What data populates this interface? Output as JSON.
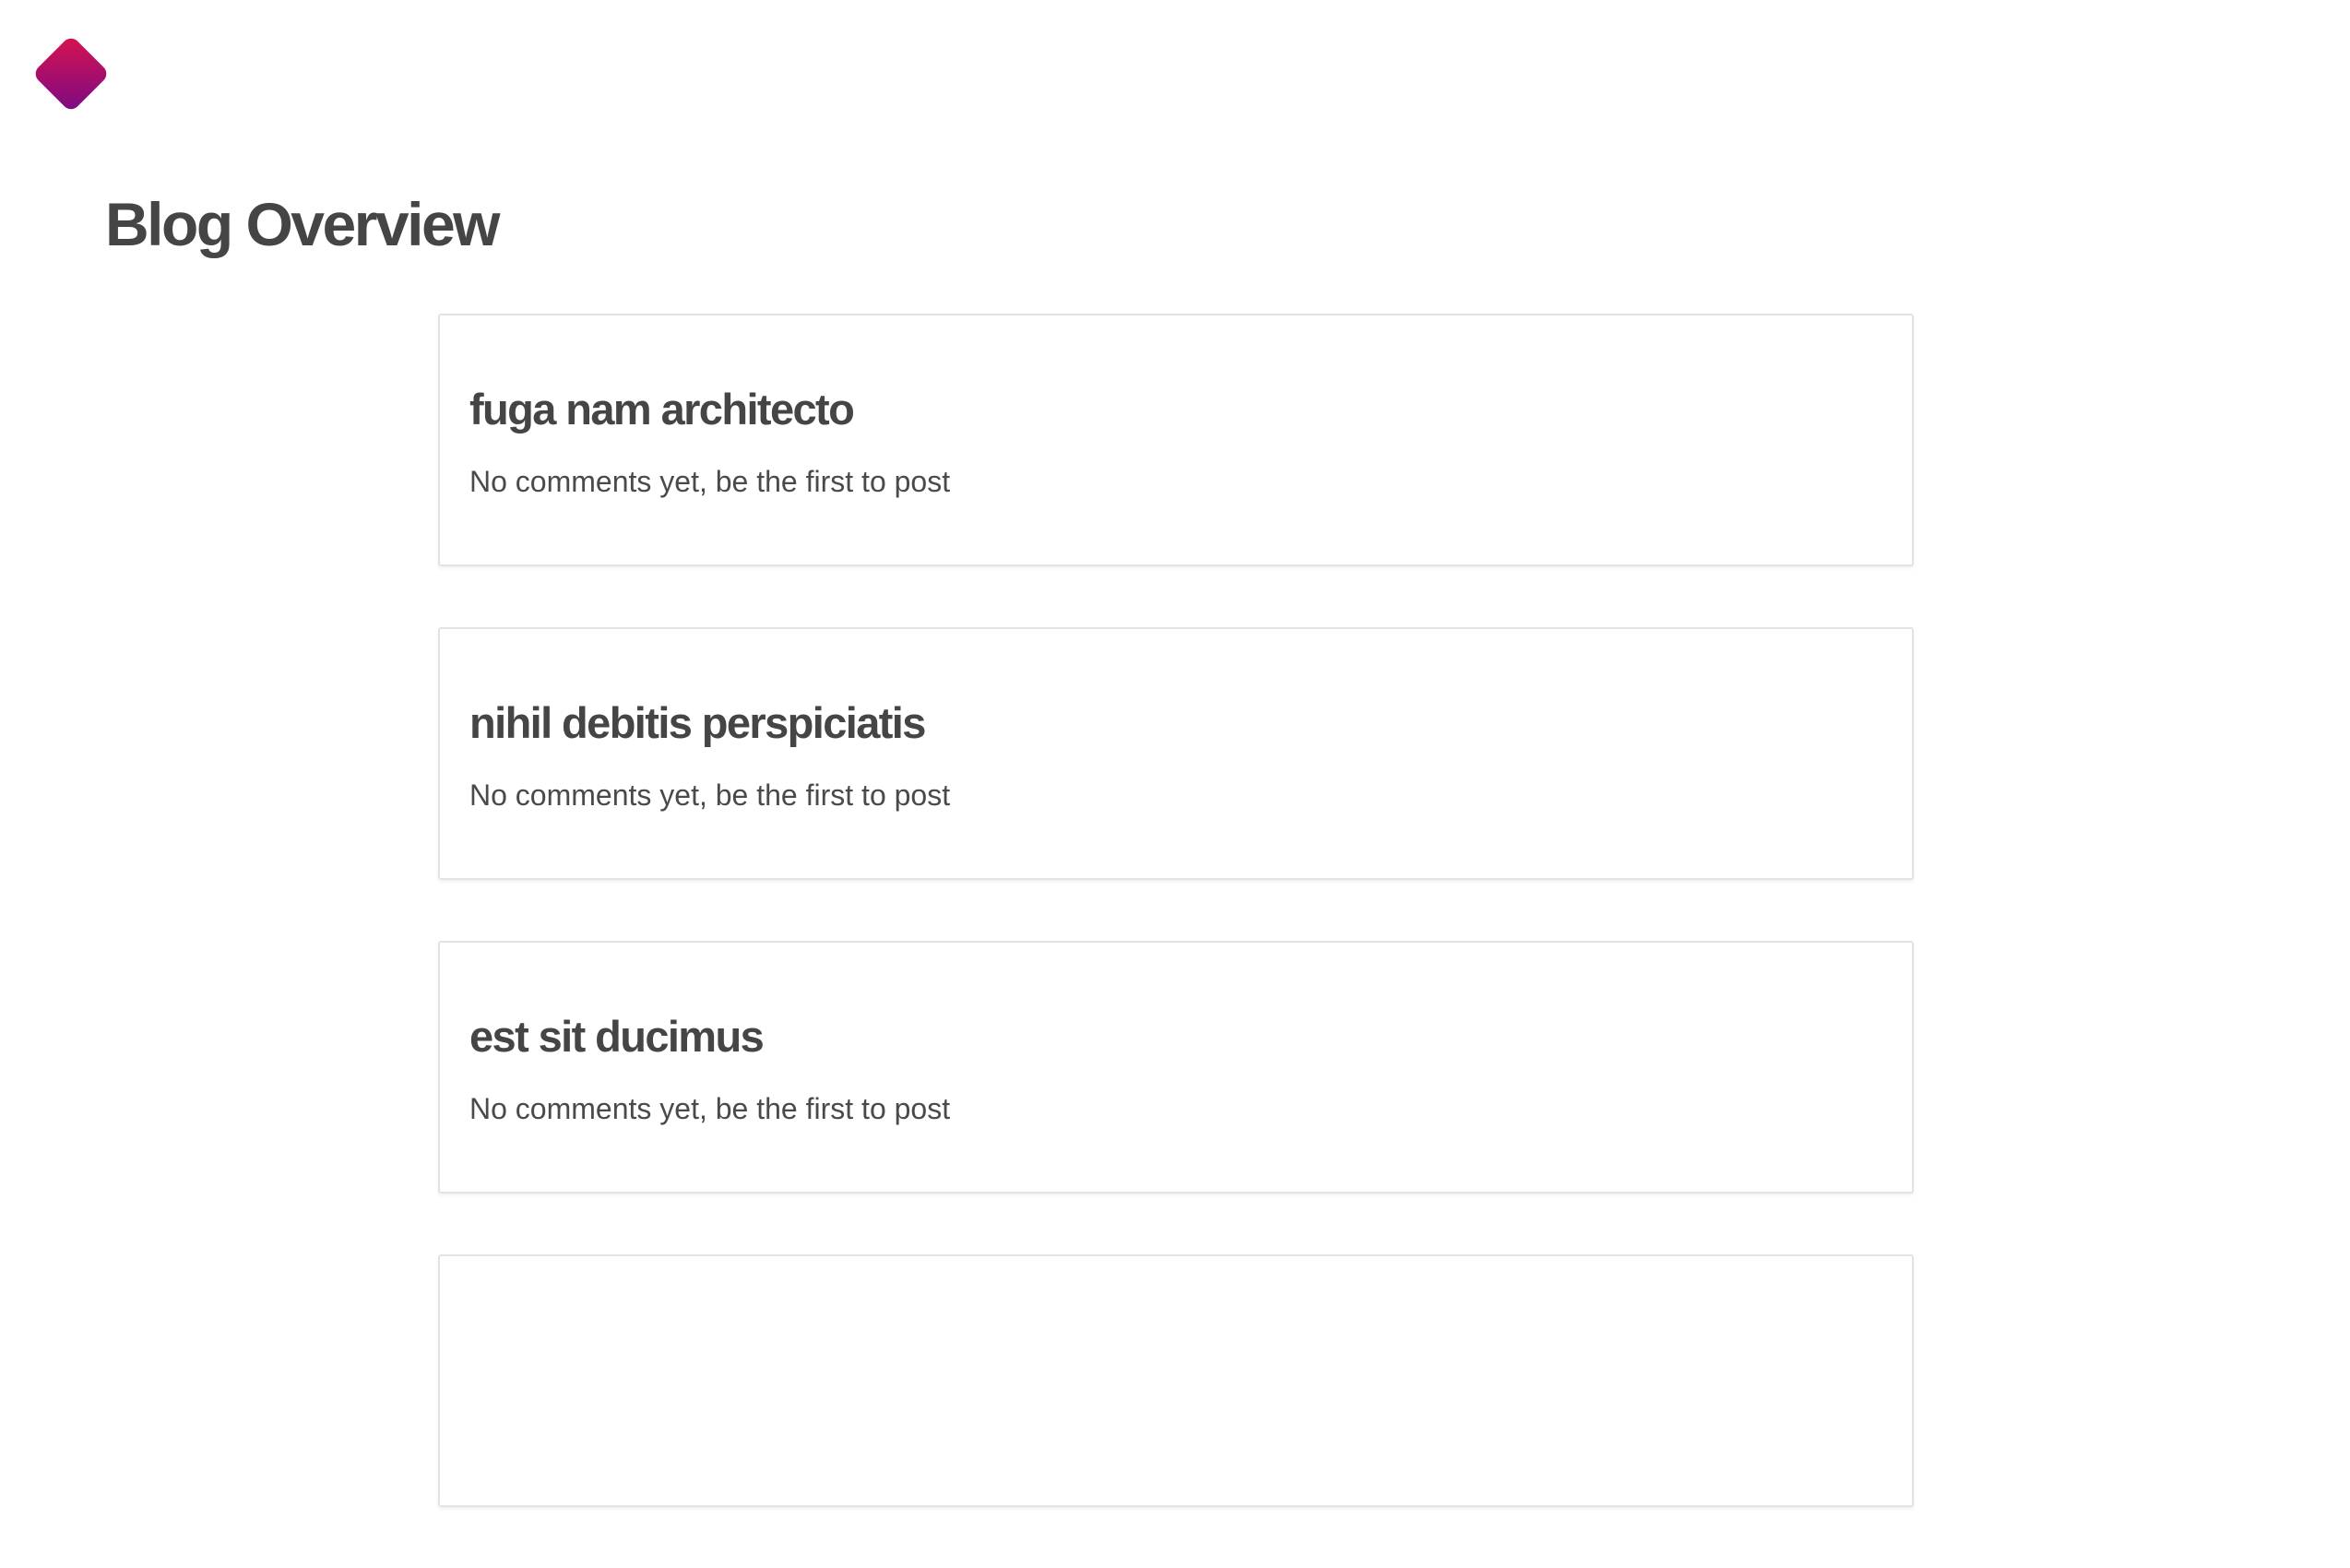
{
  "logo": {
    "icon": "diamond-logo-icon",
    "gradient_start": "#d9134f",
    "gradient_end": "#7a0a84"
  },
  "header": {
    "title": "Blog Overview"
  },
  "posts": [
    {
      "title": "fuga nam architecto",
      "comments_text": "No comments yet, be the first to post"
    },
    {
      "title": "nihil debitis perspiciatis",
      "comments_text": "No comments yet, be the first to post"
    },
    {
      "title": "est sit ducimus",
      "comments_text": "No comments yet, be the first to post"
    },
    {
      "title": "",
      "comments_text": ""
    }
  ]
}
